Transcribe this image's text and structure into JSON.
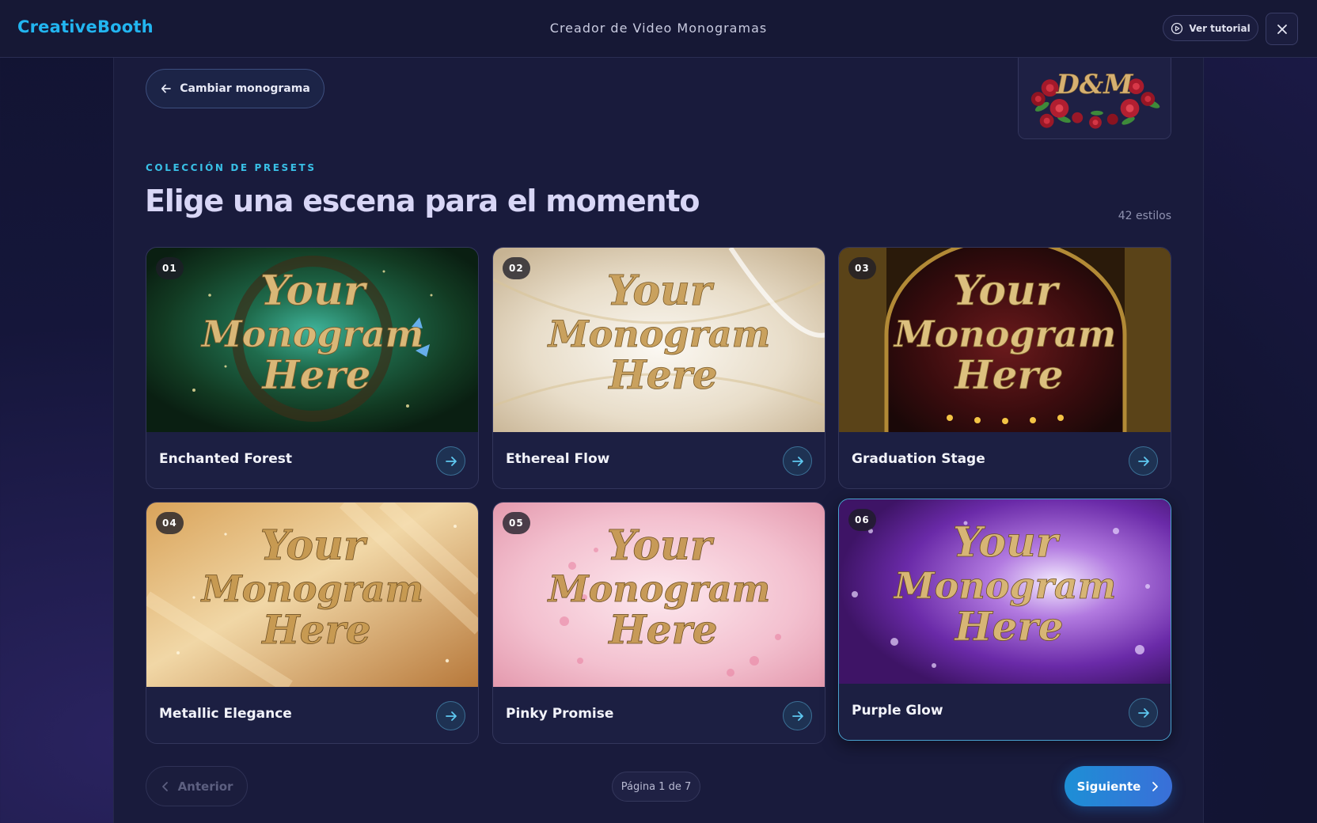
{
  "header": {
    "logo": "CreativeBooth",
    "title": "Creador de Video Monogramas",
    "tutorial_label": "Ver tutorial"
  },
  "nav": {
    "back_label": "Cambiar monograma"
  },
  "monogram_preview": {
    "initials": "D&M"
  },
  "section": {
    "eyebrow": "COLECCIÓN DE PRESETS",
    "title": "Elige una escena para el momento",
    "count": "42 estilos"
  },
  "preset_overlay_text": {
    "line1": "Your",
    "line2": "Monogram",
    "line3": "Here"
  },
  "presets": [
    {
      "num": "01",
      "name": "Enchanted Forest"
    },
    {
      "num": "02",
      "name": "Ethereal Flow"
    },
    {
      "num": "03",
      "name": "Graduation Stage"
    },
    {
      "num": "04",
      "name": "Metallic Elegance"
    },
    {
      "num": "05",
      "name": "Pinky Promise"
    },
    {
      "num": "06",
      "name": "Purple Glow"
    }
  ],
  "pagination": {
    "prev_label": "Anterior",
    "page_label": "Página 1 de 7",
    "next_label": "Siguiente"
  },
  "colors": {
    "accent": "#22b5f0",
    "eyebrow": "#39c0e6",
    "next_button": "#1d8fd6",
    "panel": "#191b3c"
  }
}
